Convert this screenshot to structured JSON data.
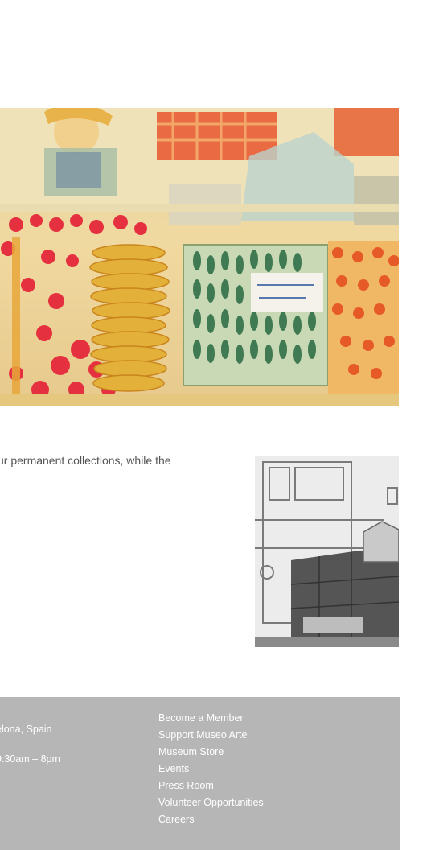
{
  "main": {
    "hero_image_alt": "watercolor painting of a market stall",
    "intro_text": "ur permanent collections, while the",
    "thumbnail_alt": "grayscale sketch of a shop interior"
  },
  "footer": {
    "address": "elona, Spain",
    "hours": "9:30am – 8pm",
    "links": [
      "Become a Member",
      "Support Museo Arte",
      "Museum Store",
      "Events",
      "Press Room",
      "Volunteer Opportunities",
      "Careers"
    ]
  },
  "colors": {
    "footer_bg": "#b6b6b6",
    "footer_text": "#ffffff",
    "body_text": "#555555"
  }
}
